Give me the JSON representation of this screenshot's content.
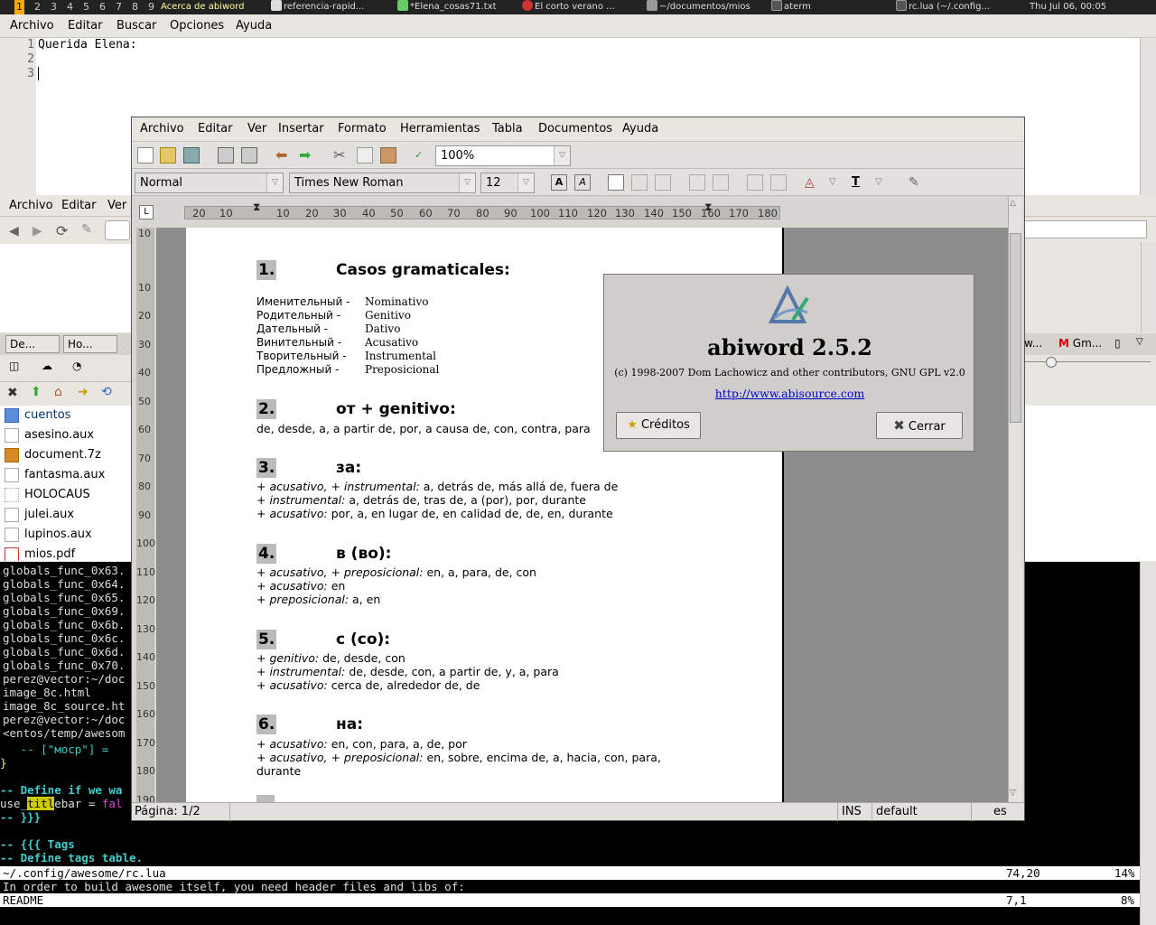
{
  "taskbar": {
    "tags": [
      "1",
      "2",
      "3",
      "4",
      "5",
      "6",
      "7",
      "8",
      "9"
    ],
    "tasks": [
      "Acerca de abiword",
      "referencia-rapid...",
      "*Elena_cosas71.txt",
      "El corto verano ...",
      "~/documentos/mios",
      "aterm",
      "rc.lua (~/.config..."
    ],
    "clock": "Thu Jul 06, 00:05"
  },
  "editor": {
    "menu": [
      "Archivo",
      "Editar",
      "Buscar",
      "Opciones",
      "Ayuda"
    ],
    "line_numbers": [
      "1",
      "2",
      "3"
    ],
    "lines": [
      "Querida Elena:"
    ]
  },
  "browser": {
    "menu": [
      "Archivo",
      "Editar",
      "Ver"
    ],
    "tabs": [
      "De...",
      "Ho...",
      "w...",
      "Gm..."
    ],
    "files": [
      "cuentos",
      "asesino.aux",
      "document.7z",
      "fantasma.aux",
      "HOLOCAUS",
      "julei.aux",
      "lupinos.aux",
      "mios.pdf"
    ]
  },
  "terminal": {
    "lines": [
      "globals_func_0x63.",
      "globals_func_0x64.",
      "globals_func_0x65.",
      "globals_func_0x69.",
      "globals_func_0x6b.",
      "globals_func_0x6c.",
      "globals_func_0x6d.",
      "globals_func_0x70.",
      "perez@vector:~/doc",
      "image_8c.html",
      "image_8c_source.ht",
      "perez@vector:~/doc",
      "<entos/temp/awesom"
    ]
  },
  "abiword": {
    "menu": [
      "Archivo",
      "Editar",
      "Ver",
      "Insertar",
      "Formato",
      "Herramientas",
      "Tabla",
      "Documentos",
      "Ayuda"
    ],
    "zoom": "100%",
    "style": "Normal",
    "font": "Times New Roman",
    "size": "12",
    "ruler_labels": [
      "20",
      "10",
      "10",
      "20",
      "30",
      "40",
      "50",
      "60",
      "70",
      "80",
      "90",
      "100",
      "110",
      "120",
      "130",
      "140",
      "150",
      "160",
      "170",
      "180"
    ],
    "vruler_labels": [
      "10",
      "10",
      "20",
      "30",
      "40",
      "50",
      "60",
      "70",
      "80",
      "90",
      "100",
      "110",
      "120",
      "130",
      "140",
      "150",
      "160",
      "170",
      "180",
      "190"
    ],
    "status": {
      "page": "Página: 1/2",
      "mode": "INS",
      "style": "default",
      "lang": "es"
    },
    "doc": {
      "s1": {
        "num": "1.",
        "title": "Casos gramaticales:",
        "rows": [
          [
            "Именительный -",
            "Nominativo"
          ],
          [
            "Родительный -",
            "Genitivo"
          ],
          [
            "Дательный -",
            "Dativo"
          ],
          [
            "Винительный -",
            "Acusativo"
          ],
          [
            "Творительный -",
            "Instrumental"
          ],
          [
            "Предложный -",
            "Preposicional"
          ]
        ]
      },
      "s2": {
        "num": "2.",
        "title": "от + genitivo:",
        "line": "de, desde, a, a partir de, por, a causa de, con, contra, para"
      },
      "s3": {
        "num": "3.",
        "title": "за:",
        "l1i": "+ acusativo, + instrumental:",
        "l1": " a, detrás de, más allá de, fuera de",
        "l2i": "+ instrumental:",
        "l2": " a, detrás de, tras de, a (por), por, durante",
        "l3i": "+ acusativo:",
        "l3": " por, a, en lugar de, en calidad de, de, en, durante"
      },
      "s4": {
        "num": "4.",
        "title": "в (во):",
        "l1i": "+ acusativo, + preposicional:",
        "l1": " en, a, para, de, con",
        "l2i": "+ acusativo:",
        "l2": " en",
        "l3i": "+ preposicional:",
        "l3": " a, en"
      },
      "s5": {
        "num": "5.",
        "title": "с (со):",
        "l1i": "+ genitivo:",
        "l1": " de, desde, con",
        "l2i": "+ instrumental:",
        "l2": " de, desde, con, a partir de, y, a, para",
        "l3i": "+ acusativo:",
        "l3": " cerca de, alrededor de, de"
      },
      "s6": {
        "num": "6.",
        "title": "на:",
        "l1i": "+ acusativo:",
        "l1": " en, con, para, a, de, por",
        "l2i": "+ acusativo, + preposicional:",
        "l2": " en, sobre, encima de, a, hacia, con, para,",
        "l3": "durante"
      }
    }
  },
  "about": {
    "title": "abiword 2.5.2",
    "copyright": "(c) 1998-2007 Dom Lachowicz and other contributors, GNU GPL v2.0",
    "url": "http://www.abisource.com",
    "credits_btn": "Créditos",
    "close_btn": "Cerrar"
  },
  "vim": {
    "line1": "   -- [\"мocp\"] =",
    "line2": "}",
    "line3": "-- Define if we wa",
    "line4a": "use_",
    "line4hl": "titl",
    "line4b": "ebar = ",
    "line4c": "fal",
    "line5": "-- }}}",
    "line6": "-- {{{ Tags",
    "line7": "-- Define tags table.",
    "status1": "~/.config/awesome/rc.lua",
    "status1_pos": "74,20",
    "status1_pct": "14%",
    "line8": "In order to build awesome itself, you need header files and libs of:",
    "status2": "README",
    "status2_pos": "7,1",
    "status2_pct": "8%"
  }
}
